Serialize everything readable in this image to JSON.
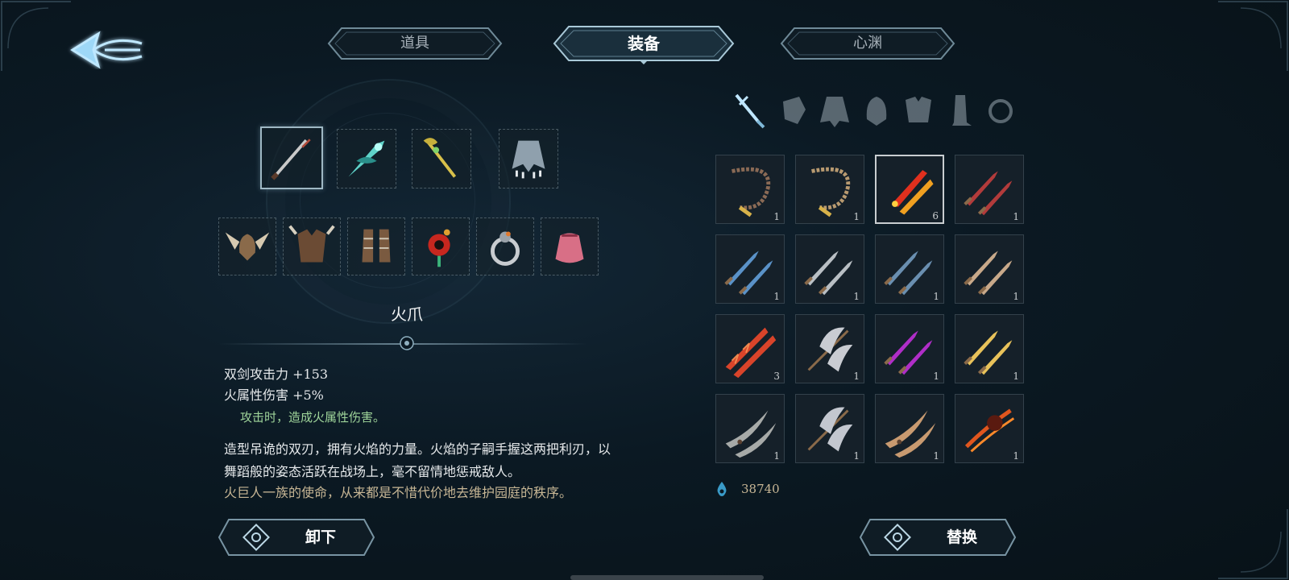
{
  "tabs": [
    {
      "label": "道具",
      "active": false
    },
    {
      "label": "装备",
      "active": true
    },
    {
      "label": "心渊",
      "active": false
    }
  ],
  "equipped_top": [
    {
      "icon": "katana-icon",
      "selected": true
    },
    {
      "icon": "ice-blade-icon",
      "selected": false
    },
    {
      "icon": "golden-staff-icon",
      "selected": false
    },
    {
      "icon": "cloak-icon",
      "selected": false
    }
  ],
  "equipped_bottom": [
    {
      "icon": "winged-helmet-icon"
    },
    {
      "icon": "chest-armor-icon"
    },
    {
      "icon": "boots-icon"
    },
    {
      "icon": "amulet-icon"
    },
    {
      "icon": "ring-icon"
    },
    {
      "icon": "pouch-icon"
    }
  ],
  "item": {
    "name": "火爪",
    "stats": [
      "双剑攻击力 +153",
      "火属性伤害 +5%"
    ],
    "effect": "攻击时，造成火属性伤害。",
    "description": "造型吊诡的双刃，拥有火焰的力量。火焰的子嗣手握这两把利刃，以舞蹈般的姿态活跃在战场上，毫不留情地惩戒敌人。",
    "lore": "火巨人一族的使命，从来都是不惜代价地去维护园庭的秩序。"
  },
  "buttons": {
    "unequip": "卸下",
    "replace": "替换"
  },
  "categories": [
    {
      "icon": "sword-icon",
      "active": true
    },
    {
      "icon": "gauntlet-icon",
      "active": false
    },
    {
      "icon": "coat-icon",
      "active": false
    },
    {
      "icon": "helmet-icon",
      "active": false
    },
    {
      "icon": "breastplate-icon",
      "active": false
    },
    {
      "icon": "greave-icon",
      "active": false
    },
    {
      "icon": "ring-icon",
      "active": false
    }
  ],
  "inventory": [
    {
      "icon": "whip-icon",
      "count": "1",
      "color": "#8a6a55"
    },
    {
      "icon": "whip-icon",
      "count": "1",
      "color": "#b89a70"
    },
    {
      "icon": "fire-claw-icon",
      "count": "6",
      "color": "#e0301e",
      "selected": true
    },
    {
      "icon": "twin-blade-icon",
      "count": "1",
      "color": "#b23b3b"
    },
    {
      "icon": "twin-blade-icon",
      "count": "1",
      "color": "#5a92c8"
    },
    {
      "icon": "twin-blade-icon",
      "count": "1",
      "color": "#b9bfc4"
    },
    {
      "icon": "twin-blade-icon",
      "count": "1",
      "color": "#6a8fb0"
    },
    {
      "icon": "twin-blade-icon",
      "count": "1",
      "color": "#c8a98a"
    },
    {
      "icon": "serrated-blade-icon",
      "count": "3",
      "color": "#d9442a"
    },
    {
      "icon": "axe-blade-icon",
      "count": "1",
      "color": "#c9ccd2"
    },
    {
      "icon": "twin-blade-icon",
      "count": "1",
      "color": "#b02ec8"
    },
    {
      "icon": "twin-blade-icon",
      "count": "1",
      "color": "#e8c25a"
    },
    {
      "icon": "curved-blade-icon",
      "count": "1",
      "color": "#a7aaa8"
    },
    {
      "icon": "axe-blade-icon",
      "count": "1",
      "color": "#c3c7cf"
    },
    {
      "icon": "curved-blade-icon",
      "count": "1",
      "color": "#c89a70"
    },
    {
      "icon": "flame-blade-icon",
      "count": "1",
      "color": "#e0561e"
    }
  ],
  "currency": {
    "icon": "soul-drop-icon",
    "value": "38740"
  }
}
